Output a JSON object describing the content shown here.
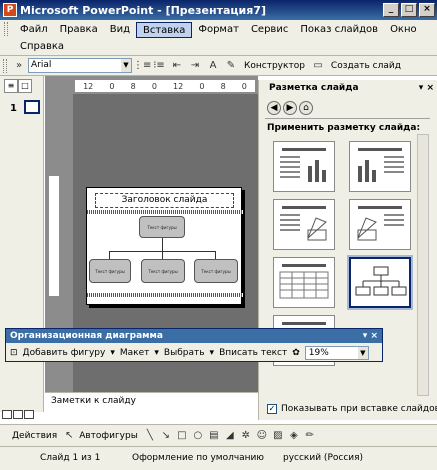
{
  "window": {
    "title": "Microsoft PowerPoint - [Презентация7]",
    "app_icon": "P",
    "controls": {
      "minimize": "_",
      "maximize": "□",
      "close": "×"
    }
  },
  "menu": {
    "row1": [
      "Файл",
      "Правка",
      "Вид",
      "Вставка",
      "Формат",
      "Сервис",
      "Показ слайдов",
      "Окно"
    ],
    "row2": [
      "Справка"
    ],
    "hot_item": "Вставка"
  },
  "formatting": {
    "font_name": "Arial",
    "designer_label": "Конструктор",
    "new_slide_label": "Создать слайд"
  },
  "outline_pane": {
    "tab_outline": "≡",
    "tab_slides": "□",
    "slide_number": "1"
  },
  "slide": {
    "title_placeholder": "Заголовок слайда",
    "box_text": "Текст фигуры",
    "ruler_ticks": [
      "12",
      "0",
      "8",
      "0",
      "12",
      "0",
      "8",
      "0"
    ]
  },
  "notes": {
    "placeholder": "Заметки к слайду"
  },
  "task_pane": {
    "title": "Разметка слайда",
    "controls": "▾ ×",
    "apply_label": "Применить разметку слайда:",
    "show_on_insert_label": "Показывать при вставке слайдов",
    "show_on_insert_checked": "✓"
  },
  "org_toolbar": {
    "title": "Организационная диаграмма",
    "controls": "▾ ×",
    "add_shape": "Добавить фигуру",
    "layout": "Макет",
    "select": "Выбрать",
    "fit_text": "Вписать текст",
    "zoom": "19%"
  },
  "draw_toolbar": {
    "actions": "Действия",
    "autoshapes": "Автофигуры"
  },
  "status": {
    "slide": "Слайд 1 из 1",
    "design": "Оформление по умолчанию",
    "language": "русский (Россия)"
  }
}
